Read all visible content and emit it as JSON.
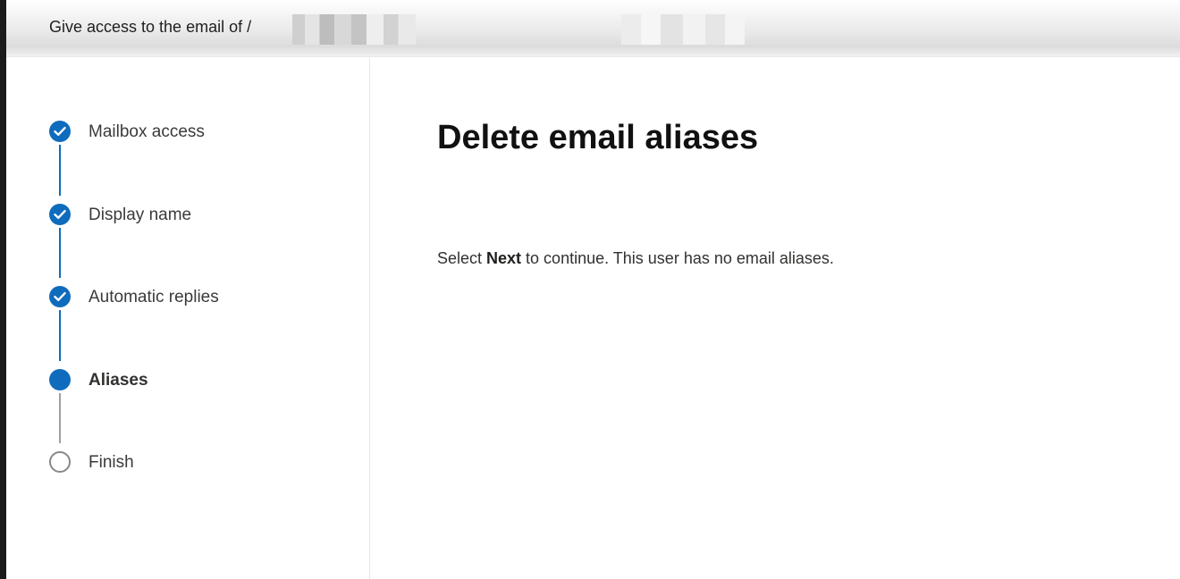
{
  "header": {
    "title": "Give access to the email of /"
  },
  "wizard": {
    "steps": [
      {
        "label": "Mailbox access",
        "state": "completed",
        "icon": "checkmark-circle-icon"
      },
      {
        "label": "Display name",
        "state": "completed",
        "icon": "checkmark-circle-icon"
      },
      {
        "label": "Automatic replies",
        "state": "completed",
        "icon": "checkmark-circle-icon"
      },
      {
        "label": "Aliases",
        "state": "current",
        "icon": "filled-circle-icon"
      },
      {
        "label": "Finish",
        "state": "pending",
        "icon": "empty-circle-icon"
      }
    ]
  },
  "main": {
    "title": "Delete email aliases",
    "message": {
      "prefix": "Select ",
      "bold": "Next",
      "suffix": " to continue. This user has no email aliases."
    }
  },
  "colors": {
    "accent": "#0f6cbd",
    "pending": "#a19f9d",
    "text": "#323130"
  }
}
